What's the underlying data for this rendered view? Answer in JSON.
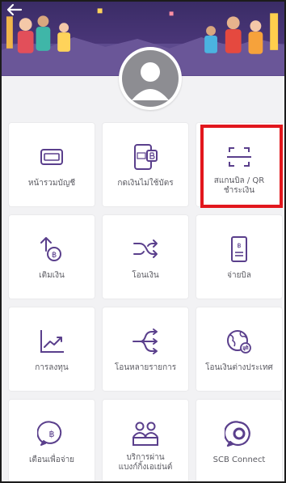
{
  "header": {
    "back_icon": "back-arrow-icon",
    "avatar_icon": "user-avatar-icon"
  },
  "menu": {
    "rows": [
      [
        {
          "id": "account-summary",
          "label": "หน้ารวมบัญชี",
          "icon": "account-card-icon"
        },
        {
          "id": "cardless-withdraw",
          "label": "กดเงินไม่ใช้บัตร",
          "icon": "atm-phone-icon"
        },
        {
          "id": "scan-qr",
          "label": "สแกนบิล / QR\nชำระเงิน",
          "icon": "scan-qr-icon",
          "highlighted": true
        }
      ],
      [
        {
          "id": "top-up",
          "label": "เติมเงิน",
          "icon": "top-up-icon"
        },
        {
          "id": "transfer",
          "label": "โอนเงิน",
          "icon": "transfer-icon"
        },
        {
          "id": "pay-bill",
          "label": "จ่ายบิล",
          "icon": "bill-icon"
        }
      ],
      [
        {
          "id": "invest",
          "label": "การลงทุน",
          "icon": "chart-icon"
        },
        {
          "id": "multi-transfer",
          "label": "โอนหลายรายการ",
          "icon": "multi-transfer-icon"
        },
        {
          "id": "international-transfer",
          "label": "โอนเงินต่างประเทศ",
          "icon": "globe-icon"
        }
      ],
      [
        {
          "id": "payment-reminder",
          "label": "เตือนเพื่อจ่าย",
          "icon": "reminder-icon"
        },
        {
          "id": "agent-service",
          "label": "บริการผ่าน\nแบงก์กิ้งเอเย่นต์",
          "icon": "agent-icon"
        },
        {
          "id": "scb-connect",
          "label": "SCB Connect",
          "icon": "scb-connect-icon"
        }
      ]
    ]
  },
  "colors": {
    "accent": "#5a3f8c",
    "banner": "#4a3678",
    "highlight": "#e2171d",
    "background": "#f2f2f4"
  }
}
